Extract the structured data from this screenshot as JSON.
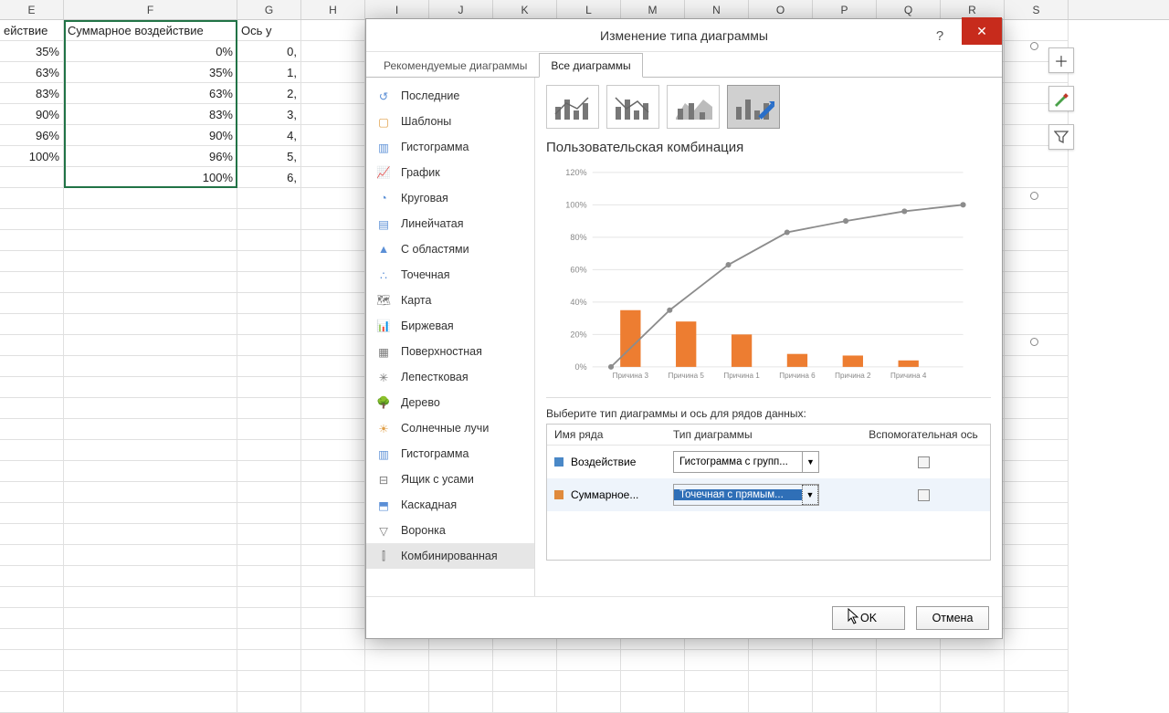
{
  "columns": [
    "E",
    "F",
    "G",
    "H",
    "I",
    "J",
    "K",
    "L",
    "M",
    "N",
    "O",
    "P",
    "Q",
    "R",
    "S"
  ],
  "sheet": {
    "header_row": [
      "ействие",
      "Суммарное воздействие",
      "Ось у"
    ],
    "rows": [
      {
        "e": "35%",
        "f": "0%",
        "g": "0,"
      },
      {
        "e": "63%",
        "f": "35%",
        "g": "1,"
      },
      {
        "e": "83%",
        "f": "63%",
        "g": "2,"
      },
      {
        "e": "90%",
        "f": "83%",
        "g": "3,"
      },
      {
        "e": "96%",
        "f": "90%",
        "g": "4,"
      },
      {
        "e": "100%",
        "f": "96%",
        "g": "5,"
      },
      {
        "e": "",
        "f": "100%",
        "g": "6,"
      }
    ]
  },
  "dialog": {
    "title": "Изменение типа диаграммы",
    "tabs": {
      "rec": "Рекомендуемые диаграммы",
      "all": "Все диаграммы"
    },
    "tree": [
      "Последние",
      "Шаблоны",
      "Гистограмма",
      "График",
      "Круговая",
      "Линейчатая",
      "С областями",
      "Точечная",
      "Карта",
      "Биржевая",
      "Поверхностная",
      "Лепестковая",
      "Дерево",
      "Солнечные лучи",
      "Гистограмма",
      "Ящик с усами",
      "Каскадная",
      "Воронка",
      "Комбинированная"
    ],
    "subtitle": "Пользовательская комбинация",
    "instruction": "Выберите тип диаграммы и ось для рядов данных:",
    "series_headers": {
      "name": "Имя ряда",
      "type": "Тип диаграммы",
      "aux": "Вспомогательная ось"
    },
    "series": [
      {
        "color": "#4a88c7",
        "name": "Воздействие",
        "type": "Гистограмма с групп..."
      },
      {
        "color": "#e08a3c",
        "name": "Суммарное...",
        "type": "Точечная с прямым..."
      }
    ],
    "buttons": {
      "ok": "OK",
      "cancel": "Отмена"
    }
  },
  "chart_data": {
    "type": "combo",
    "title": "Пользовательская комбинация",
    "categories": [
      "Причина 3",
      "Причина 5",
      "Причина 1",
      "Причина 6",
      "Причина 2",
      "Причина 4"
    ],
    "y_ticks": [
      0,
      20,
      40,
      60,
      80,
      100,
      120
    ],
    "ylabel": "%",
    "series": [
      {
        "name": "Воздействие",
        "type": "bar",
        "color": "#ed7d31",
        "values": [
          35,
          28,
          20,
          8,
          7,
          4
        ]
      },
      {
        "name": "Суммарное...",
        "type": "line",
        "color": "#8c8c8c",
        "values": [
          0,
          35,
          63,
          83,
          90,
          96,
          100
        ]
      }
    ],
    "ylim": [
      0,
      120
    ]
  }
}
